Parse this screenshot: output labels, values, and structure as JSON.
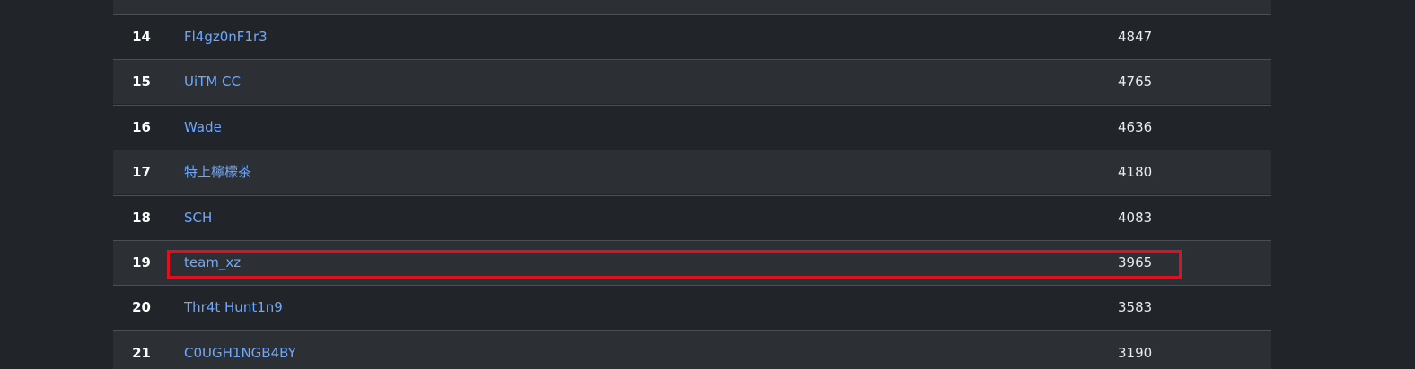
{
  "rows": [
    {
      "rank": "14",
      "team": "Fl4gz0nF1r3",
      "score": "4847"
    },
    {
      "rank": "15",
      "team": "UiTM CC",
      "score": "4765"
    },
    {
      "rank": "16",
      "team": "Wade",
      "score": "4636"
    },
    {
      "rank": "17",
      "team": "特上檸檬茶",
      "score": "4180"
    },
    {
      "rank": "18",
      "team": "SCH",
      "score": "4083"
    },
    {
      "rank": "19",
      "team": "team_xz",
      "score": "3965"
    },
    {
      "rank": "20",
      "team": "Thr4t Hunt1n9",
      "score": "3583"
    },
    {
      "rank": "21",
      "team": "C0UGH1NGB4BY",
      "score": "3190"
    }
  ],
  "highlight": {
    "color": "#e0101e",
    "row_rank": "19"
  },
  "colors": {
    "background": "#212529",
    "row_alt": "#2c3035",
    "link": "#6ea8fe",
    "text": "#ffffff"
  }
}
